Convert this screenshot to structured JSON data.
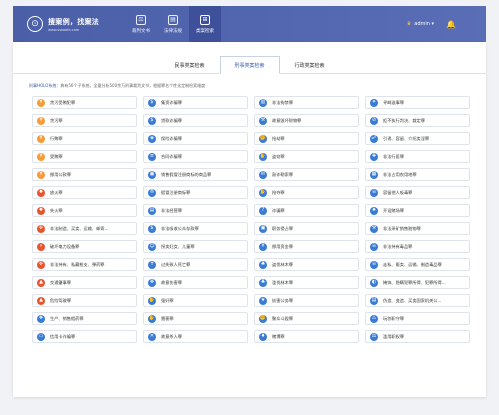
{
  "header": {
    "logo_text": "搜案例，找案法",
    "logo_sub": "www.sskaofa.com",
    "nav": [
      {
        "label": "裁判文书",
        "icon": "scales-icon",
        "glyph": "⚖"
      },
      {
        "label": "法律法规",
        "icon": "book-icon",
        "glyph": "▤"
      },
      {
        "label": "类案检索",
        "icon": "grid-search-icon",
        "glyph": "⊞"
      }
    ],
    "user": "admin ▾",
    "colors": {
      "bar": "#4a5fa8",
      "active": "#3f509a",
      "crown": "#f4c542"
    }
  },
  "tabs": [
    {
      "label": "民事类案检索"
    },
    {
      "label": "刑事类案检索"
    },
    {
      "label": "行政类案检索"
    }
  ],
  "active_tab": 1,
  "desc": {
    "brand": "刑事HOLO系统：",
    "text": "典有56个子系统，全量分析500余万刑事裁判文书，根据罪名个性化定制检索维度"
  },
  "crimes": [
    {
      "label": "贪污受贿犯罪",
      "color": "#f39c38",
      "icon": "money-icon",
      "glyph": "¥"
    },
    {
      "label": "集资诈骗罪",
      "color": "#3a7bd5",
      "icon": "coins-icon",
      "glyph": "$"
    },
    {
      "label": "非法拘禁罪",
      "color": "#3a7bd5",
      "icon": "jail-icon",
      "glyph": "▥"
    },
    {
      "label": "寻衅滋事罪",
      "color": "#3a7bd5",
      "icon": "person-icon",
      "glyph": "✦"
    },
    {
      "label": "贪污罪",
      "color": "#f39c38",
      "icon": "money-icon",
      "glyph": "¥"
    },
    {
      "label": "贷款诈骗罪",
      "color": "#3a7bd5",
      "icon": "loan-icon",
      "glyph": "$"
    },
    {
      "label": "故意毁坏财物罪",
      "color": "#3a7bd5",
      "icon": "broken-icon",
      "glyph": "⚒"
    },
    {
      "label": "拒不执行判决、裁定罪",
      "color": "#3a7bd5",
      "icon": "ban-icon",
      "glyph": "⊘"
    },
    {
      "label": "行贿罪",
      "color": "#f39c38",
      "icon": "bribe-icon",
      "glyph": "¥"
    },
    {
      "label": "保险诈骗罪",
      "color": "#3a7bd5",
      "icon": "shield-icon",
      "glyph": "◈"
    },
    {
      "label": "抢劫罪",
      "color": "#3a7bd5",
      "icon": "robbery-icon",
      "glyph": "✊"
    },
    {
      "label": "引诱、容留、介绍卖淫罪",
      "color": "#3a7bd5",
      "icon": "people-icon",
      "glyph": "☍"
    },
    {
      "label": "受贿罪",
      "color": "#f39c38",
      "icon": "bribe-icon",
      "glyph": "¥"
    },
    {
      "label": "合同诈骗罪",
      "color": "#3a7bd5",
      "icon": "contract-icon",
      "glyph": "≡"
    },
    {
      "label": "盗窃罪",
      "color": "#3a7bd5",
      "icon": "theft-icon",
      "glyph": "✋"
    },
    {
      "label": "非法行医罪",
      "color": "#3a7bd5",
      "icon": "medical-icon",
      "glyph": "✚"
    },
    {
      "label": "挪用公款罪",
      "color": "#f39c38",
      "icon": "funds-icon",
      "glyph": "¥"
    },
    {
      "label": "销售假冒注册商标的商品罪",
      "color": "#3a7bd5",
      "icon": "fake-icon",
      "glyph": "▣"
    },
    {
      "label": "敲诈勒索罪",
      "color": "#3a7bd5",
      "icon": "extortion-icon",
      "glyph": "✉"
    },
    {
      "label": "非法占用农用地罪",
      "color": "#3a7bd5",
      "icon": "land-icon",
      "glyph": "▦"
    },
    {
      "label": "放火罪",
      "color": "#e8542d",
      "icon": "fire-icon",
      "glyph": "✹"
    },
    {
      "label": "假冒注册商标罪",
      "color": "#3a7bd5",
      "icon": "trademark-icon",
      "glyph": "®"
    },
    {
      "label": "抢夺罪",
      "color": "#3a7bd5",
      "icon": "grab-icon",
      "glyph": "✋"
    },
    {
      "label": "容留他人吸毒罪",
      "color": "#3a7bd5",
      "icon": "drug-icon",
      "glyph": "☠"
    },
    {
      "label": "失火罪",
      "color": "#e8542d",
      "icon": "fire-icon",
      "glyph": "✹"
    },
    {
      "label": "非法经营罪",
      "color": "#3a7bd5",
      "icon": "business-icon",
      "glyph": "▤"
    },
    {
      "label": "诈骗罪",
      "color": "#3a7bd5",
      "icon": "fraud-icon",
      "glyph": "?"
    },
    {
      "label": "开设赌场罪",
      "color": "#3a7bd5",
      "icon": "casino-icon",
      "glyph": "♠"
    },
    {
      "label": "非法制造、买卖、运输、邮寄...",
      "color": "#e8542d",
      "icon": "gun-icon",
      "glyph": "✜"
    },
    {
      "label": "非法吸收公众存款罪",
      "color": "#3a7bd5",
      "icon": "deposit-icon",
      "glyph": "$"
    },
    {
      "label": "职务侵占罪",
      "color": "#3a7bd5",
      "icon": "office-icon",
      "glyph": "▣"
    },
    {
      "label": "非法采矿销售赃物罪",
      "color": "#3a7bd5",
      "icon": "mining-icon",
      "glyph": "⚒"
    },
    {
      "label": "破坏电力设备罪",
      "color": "#e8542d",
      "icon": "power-icon",
      "glyph": "⚡"
    },
    {
      "label": "拐卖妇女、儿童罪",
      "color": "#3a7bd5",
      "icon": "child-icon",
      "glyph": "☺"
    },
    {
      "label": "挪用资金罪",
      "color": "#3a7bd5",
      "icon": "funds-icon",
      "glyph": "¥"
    },
    {
      "label": "非法持有毒品罪",
      "color": "#3a7bd5",
      "icon": "drug-icon",
      "glyph": "☠"
    },
    {
      "label": "非法持有、私藏枪支、弹药罪",
      "color": "#e8542d",
      "icon": "gun-icon",
      "glyph": "✜"
    },
    {
      "label": "过失致人死亡罪",
      "color": "#3a7bd5",
      "icon": "death-icon",
      "glyph": "✝"
    },
    {
      "label": "盗伐林木罪",
      "color": "#3a7bd5",
      "icon": "tree-icon",
      "glyph": "♣"
    },
    {
      "label": "走私、贩卖、运输、制造毒品罪",
      "color": "#3a7bd5",
      "icon": "drug-icon",
      "glyph": "☠"
    },
    {
      "label": "交通肇事罪",
      "color": "#e8542d",
      "icon": "car-icon",
      "glyph": "▲"
    },
    {
      "label": "故意伤害罪",
      "color": "#3a7bd5",
      "icon": "injury-icon",
      "glyph": "✚"
    },
    {
      "label": "滥伐林木罪",
      "color": "#3a7bd5",
      "icon": "tree-icon",
      "glyph": "♣"
    },
    {
      "label": "掩饰、隐瞒犯罪所得、犯罪所得...",
      "color": "#3a7bd5",
      "icon": "hide-icon",
      "glyph": "◐"
    },
    {
      "label": "危险驾驶罪",
      "color": "#e8542d",
      "icon": "car-icon",
      "glyph": "▲"
    },
    {
      "label": "强奸罪",
      "color": "#3a7bd5",
      "icon": "assault-icon",
      "glyph": "✋"
    },
    {
      "label": "妨害公务罪",
      "color": "#3a7bd5",
      "icon": "police-icon",
      "glyph": "★"
    },
    {
      "label": "伪造、变造、买卖国家机关公...",
      "color": "#3a7bd5",
      "icon": "document-icon",
      "glyph": "▤"
    },
    {
      "label": "生产、销售假药罪",
      "color": "#3a7bd5",
      "icon": "medicine-icon",
      "glyph": "✚"
    },
    {
      "label": "猥亵罪",
      "color": "#3a7bd5",
      "icon": "assault-icon",
      "glyph": "✋"
    },
    {
      "label": "聚众斗殴罪",
      "color": "#3a7bd5",
      "icon": "fight-icon",
      "glyph": "✊"
    },
    {
      "label": "玩忽职守罪",
      "color": "#3a7bd5",
      "icon": "neglect-icon",
      "glyph": "⚠"
    },
    {
      "label": "信用卡诈骗罪",
      "color": "#3a7bd5",
      "icon": "card-icon",
      "glyph": "▭"
    },
    {
      "label": "故意杀人罪",
      "color": "#3a7bd5",
      "icon": "knife-icon",
      "glyph": "✕"
    },
    {
      "label": "赌博罪",
      "color": "#3a7bd5",
      "icon": "gamble-icon",
      "glyph": "♦"
    },
    {
      "label": "滥用职权罪",
      "color": "#3a7bd5",
      "icon": "power-abuse-icon",
      "glyph": "⚖"
    }
  ]
}
